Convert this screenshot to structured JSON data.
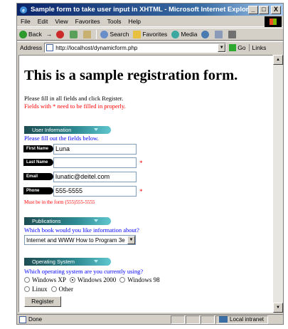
{
  "window": {
    "title": "Sample form to take user input in XHTML - Microsoft Internet Explorer",
    "controls": {
      "minimize": "_",
      "maximize": "□",
      "close": "X"
    }
  },
  "menu": [
    "File",
    "Edit",
    "View",
    "Favorites",
    "Tools",
    "Help"
  ],
  "toolbar": {
    "back": "Back",
    "forward_arrow": "→",
    "search": "Search",
    "favorites": "Favorites",
    "media": "Media"
  },
  "address": {
    "label": "Address",
    "url": "http://localhost/dynamicform.php",
    "go": "Go",
    "links": "Links"
  },
  "page": {
    "heading": "This is a sample registration form.",
    "intro": "Please fill in all fields and click Register.",
    "required_note": "Fields with * need to be filled in properly.",
    "user_section": {
      "banner": "User Information",
      "instruction": "Please fill out the fields below.",
      "fields": [
        {
          "label": "First Name",
          "value": "Luna",
          "required": false
        },
        {
          "label": "Last Name",
          "value": "",
          "required": true
        },
        {
          "label": "Email",
          "value": "lunatic@deitel.com",
          "required": false
        },
        {
          "label": "Phone",
          "value": "555-5555",
          "required": true
        }
      ],
      "star": "*",
      "phone_error": "Must be in the form (555)555-5555"
    },
    "publications_section": {
      "banner": "Publications",
      "question": "Which book would you like information about?",
      "selected_book": "Internet and WWW How to Program 3e"
    },
    "os_section": {
      "banner": "Operating System",
      "question": "Which operating system are you currently using?",
      "options": [
        "Windows XP",
        "Windows 2000",
        "Windows 98",
        "Linux",
        "Other"
      ],
      "selected": "Windows 2000"
    },
    "register_button": "Register"
  },
  "status": {
    "text": "Done",
    "zone": "Local intranet"
  },
  "colors": {
    "title_bar": "#0a246a",
    "banner": "#2f8a92",
    "link_blue": "#0000ff",
    "error_red": "#ff0000"
  }
}
